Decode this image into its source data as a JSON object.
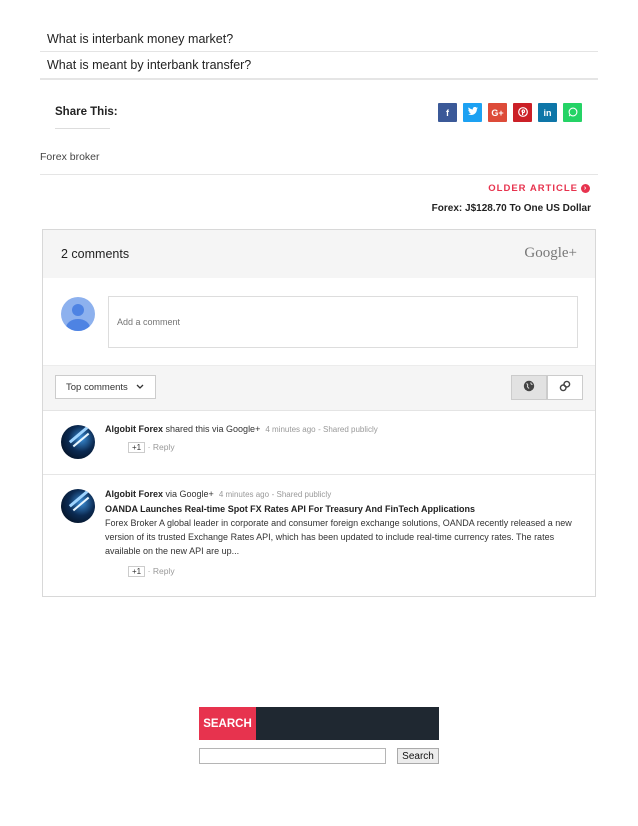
{
  "related": [
    {
      "title": "What is interbank money market?"
    },
    {
      "title": "What is meant by interbank transfer?"
    }
  ],
  "share": {
    "label": "Share This:",
    "buttons": [
      {
        "name": "facebook",
        "glyph": "f",
        "color": "#3b5998"
      },
      {
        "name": "twitter",
        "glyph": "t",
        "color": "#1da1f2"
      },
      {
        "name": "google-plus",
        "glyph": "G+",
        "color": "#dd4b39"
      },
      {
        "name": "pinterest",
        "glyph": "P",
        "color": "#cb2027"
      },
      {
        "name": "linkedin",
        "glyph": "in",
        "color": "#0e76a8"
      },
      {
        "name": "whatsapp",
        "glyph": "W",
        "color": "#25d366"
      }
    ]
  },
  "labels": {
    "forex_broker": "Forex broker"
  },
  "pager": {
    "older_label": "OLDER ARTICLE",
    "older_title": "Forex: J$128.70 To One US Dollar"
  },
  "comments": {
    "count_text": "2 comments",
    "brand": "Google+",
    "input_placeholder": "Add a comment",
    "sort_label": "Top comments",
    "items": [
      {
        "author": "Algobit Forex",
        "action": "shared this via Google+",
        "time": "4 minutes ago",
        "visibility": "Shared publicly",
        "plus_one": "+1",
        "reply": "Reply"
      },
      {
        "author": "Algobit Forex",
        "action": "via Google+",
        "time": "4 minutes ago",
        "visibility": "Shared publicly",
        "title": "OANDA Launches Real-time Spot FX Rates API For Treasury And FinTech Applications",
        "body": "Forex Broker A global leader in corporate and consumer foreign exchange solutions, OANDA recently released a new version of its trusted Exchange Rates API, which has been updated to include real-time currency rates. The rates available on the new API are up...",
        "plus_one": "+1",
        "reply": "Reply"
      }
    ]
  },
  "search_widget": {
    "title": "SEARCH",
    "button_label": "Search"
  }
}
